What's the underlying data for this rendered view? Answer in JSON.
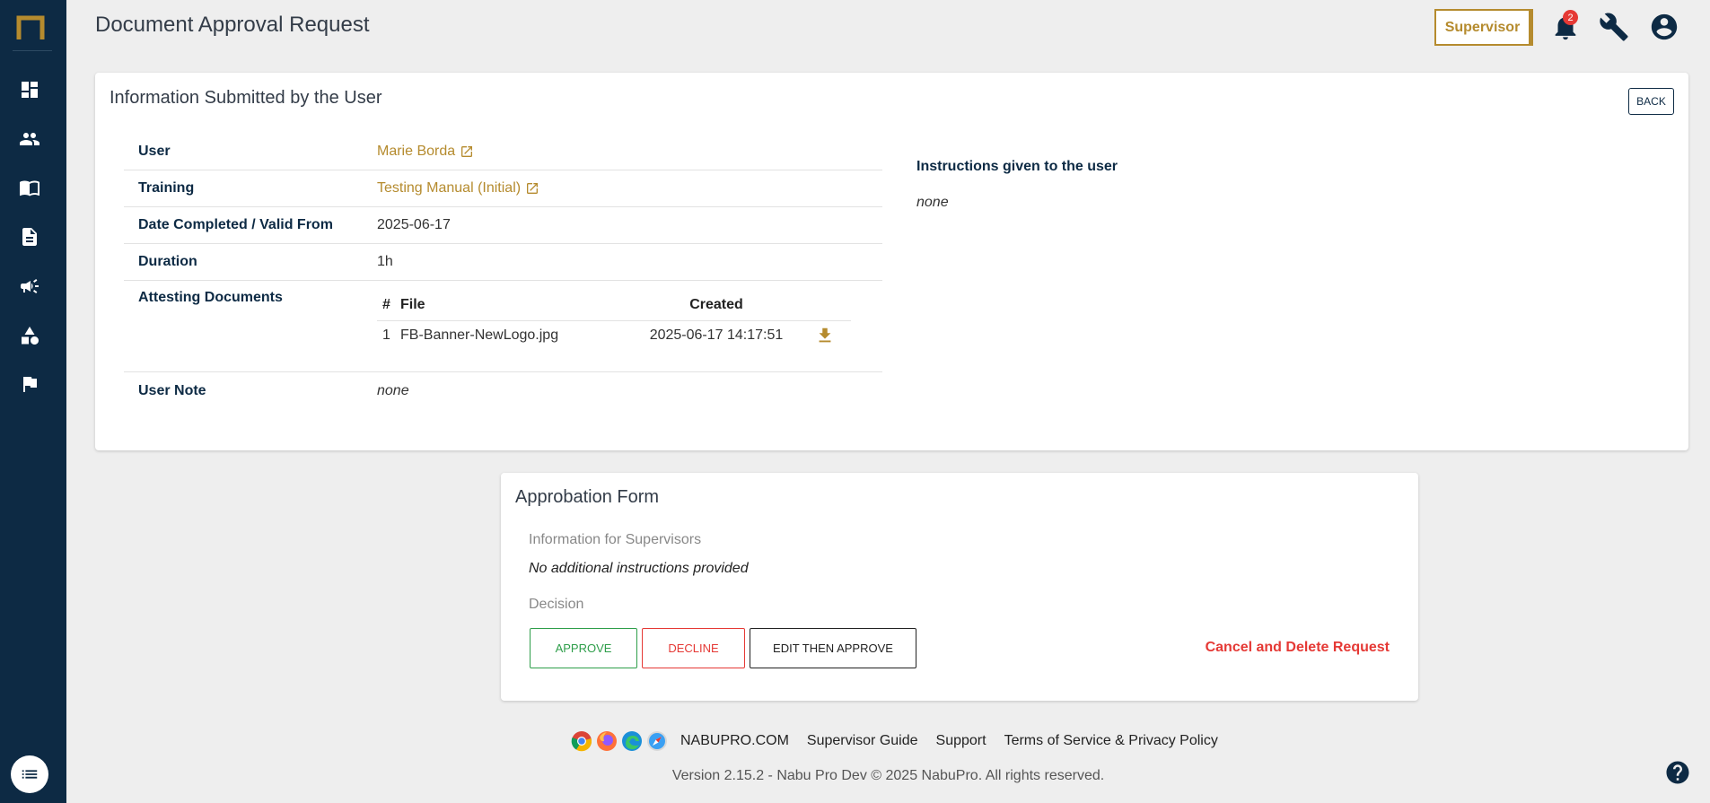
{
  "header": {
    "title": "Document Approval Request",
    "role": "Supervisor",
    "notification_count": "2"
  },
  "info_card": {
    "title": "Information Submitted by the User",
    "back_label": "BACK",
    "rows": {
      "user": {
        "label": "User",
        "value": "Marie Borda"
      },
      "training": {
        "label": "Training",
        "value": "Testing Manual (Initial)"
      },
      "date": {
        "label": "Date Completed / Valid From",
        "value": "2025-06-17"
      },
      "duration": {
        "label": "Duration",
        "value": "1h"
      },
      "docs": {
        "label": "Attesting Documents"
      },
      "note": {
        "label": "User Note",
        "value": "none"
      }
    },
    "docs_table": {
      "headers": {
        "num": "#",
        "file": "File",
        "created": "Created"
      },
      "rows": [
        {
          "num": "1",
          "file": "FB-Banner-NewLogo.jpg",
          "created": "2025-06-17 14:17:51"
        }
      ]
    },
    "instructions_title": "Instructions given to the user",
    "instructions_value": "none"
  },
  "approbation": {
    "title": "Approbation Form",
    "info_label": "Information for Supervisors",
    "info_value": "No additional instructions provided",
    "decision_label": "Decision",
    "approve": "APPROVE",
    "decline": "DECLINE",
    "edit_approve": "EDIT THEN APPROVE",
    "cancel": "Cancel and Delete Request"
  },
  "footer": {
    "links": [
      "NABUPRO.COM",
      "Supervisor Guide",
      "Support",
      "Terms of Service & Privacy Policy"
    ],
    "version": "Version 2.15.2 - Nabu Pro Dev © 2025 NabuPro. All rights reserved."
  },
  "colors": {
    "sidebar": "#0d2a44",
    "accent": "#b58b2e",
    "approve": "#2e9e4a",
    "danger": "#e53935"
  }
}
